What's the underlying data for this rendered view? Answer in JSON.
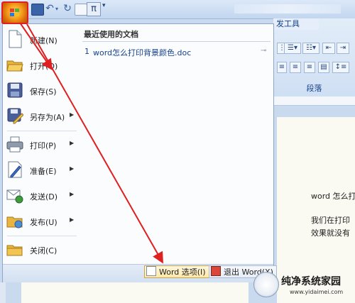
{
  "ribbon": {
    "tab_dev": "发工具",
    "paragraph_group": "段落"
  },
  "office_menu": {
    "commands": [
      {
        "label": "新建(N)",
        "icon": "new-doc-icon"
      },
      {
        "label": "打开(O)",
        "icon": "open-folder-icon"
      },
      {
        "label": "保存(S)",
        "icon": "save-icon"
      },
      {
        "label": "另存为(A)",
        "icon": "save-as-icon",
        "submenu": true
      },
      {
        "label": "打印(P)",
        "icon": "printer-icon",
        "submenu": true
      },
      {
        "label": "准备(E)",
        "icon": "prepare-icon",
        "submenu": true
      },
      {
        "label": "发送(D)",
        "icon": "send-icon",
        "submenu": true
      },
      {
        "label": "发布(U)",
        "icon": "publish-icon",
        "submenu": true
      },
      {
        "label": "关闭(C)",
        "icon": "close-folder-icon"
      }
    ],
    "recent_title": "最近使用的文档",
    "recent_docs": [
      {
        "index": "1",
        "name": "word怎么打印背景颜色.doc"
      }
    ],
    "footer": {
      "options_label": "Word 选项(I)",
      "exit_label": "退出 Word(X)"
    }
  },
  "document": {
    "lines": [
      "word 怎么打",
      "我们在打印",
      "效果就没有"
    ]
  },
  "watermark": {
    "text": "纯净系统家园",
    "url": "www.yidaimei.com"
  },
  "colors": {
    "annotation_arrow": "#e02020",
    "office_orb": "#f59b1a"
  }
}
